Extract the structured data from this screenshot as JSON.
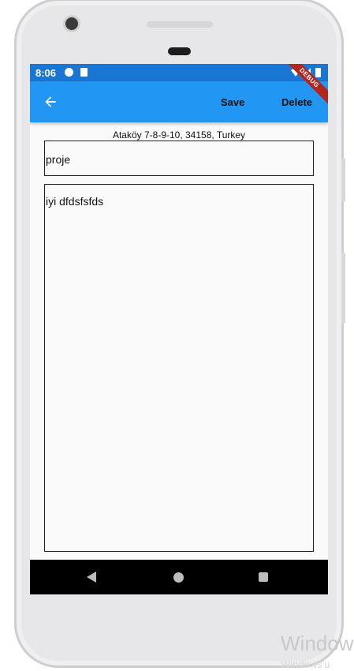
{
  "status_bar": {
    "time": "8:06",
    "background": "#1976d2",
    "icons": [
      "notification-icon",
      "sd-card-icon",
      "wifi-icon",
      "signal-icon",
      "battery-icon"
    ]
  },
  "app_bar": {
    "background": "#2196f3",
    "back_icon": "arrow-back-icon",
    "save_label": "Save",
    "delete_label": "Delete",
    "debug_banner": "DEBUG"
  },
  "content": {
    "address": "Ataköy 7-8-9-10, 34158, Turkey",
    "title_value": "proje",
    "note_value": "iyi dfdsfsfds"
  },
  "nav_bar": {
    "icons": [
      "back-triangle-icon",
      "home-circle-icon",
      "recents-square-icon"
    ]
  },
  "overlay": {
    "watermark": "Window",
    "watermark_sub": "Windows'u"
  }
}
